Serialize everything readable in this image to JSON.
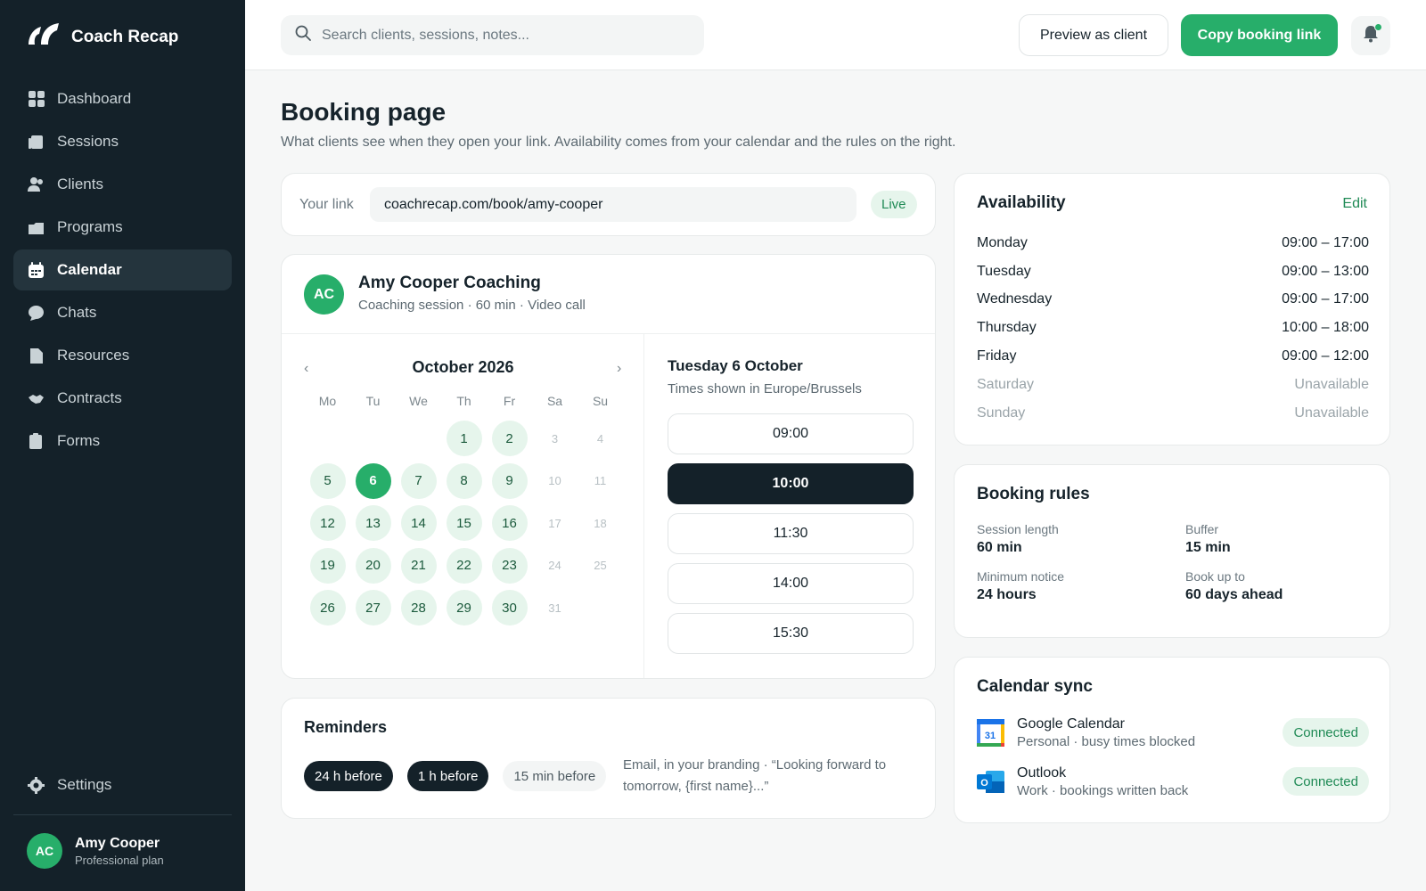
{
  "app": {
    "name": "Coach Recap"
  },
  "nav": {
    "items": [
      {
        "label": "Dashboard",
        "icon": "dashboard-icon"
      },
      {
        "label": "Sessions",
        "icon": "sessions-icon"
      },
      {
        "label": "Clients",
        "icon": "clients-icon"
      },
      {
        "label": "Programs",
        "icon": "programs-icon"
      },
      {
        "label": "Calendar",
        "icon": "calendar-icon",
        "active": true
      },
      {
        "label": "Chats",
        "icon": "chat-icon"
      },
      {
        "label": "Resources",
        "icon": "resources-icon"
      },
      {
        "label": "Contracts",
        "icon": "contracts-icon"
      },
      {
        "label": "Forms",
        "icon": "forms-icon"
      }
    ],
    "settings_label": "Settings"
  },
  "user": {
    "initials": "AC",
    "name": "Amy Cooper",
    "plan": "Professional plan"
  },
  "topbar": {
    "search_placeholder": "Search clients, sessions, notes...",
    "preview_label": "Preview as client",
    "copy_label": "Copy booking link"
  },
  "page": {
    "title": "Booking page",
    "subtitle": "What clients see when they open your link. Availability comes from your calendar and the rules on the right."
  },
  "link": {
    "label": "Your link",
    "url": "coachrecap.com/book/amy-cooper",
    "status": "Live"
  },
  "widget": {
    "initials": "AC",
    "coach_name": "Amy Cooper Coaching",
    "meta": "Coaching session · 60 min · Video call",
    "calendar": {
      "prev": "‹",
      "next": "›",
      "month": "October 2026",
      "weekdays": [
        "Mo",
        "Tu",
        "We",
        "Th",
        "Fr",
        "Sa",
        "Su"
      ],
      "lead_blanks": 3,
      "days": [
        {
          "n": "1",
          "s": "avail"
        },
        {
          "n": "2",
          "s": "avail"
        },
        {
          "n": "3",
          "s": "unavail"
        },
        {
          "n": "4",
          "s": "unavail"
        },
        {
          "n": "5",
          "s": "avail"
        },
        {
          "n": "6",
          "s": "selected"
        },
        {
          "n": "7",
          "s": "avail"
        },
        {
          "n": "8",
          "s": "avail"
        },
        {
          "n": "9",
          "s": "avail"
        },
        {
          "n": "10",
          "s": "unavail"
        },
        {
          "n": "11",
          "s": "unavail"
        },
        {
          "n": "12",
          "s": "avail"
        },
        {
          "n": "13",
          "s": "avail"
        },
        {
          "n": "14",
          "s": "avail"
        },
        {
          "n": "15",
          "s": "avail"
        },
        {
          "n": "16",
          "s": "avail"
        },
        {
          "n": "17",
          "s": "unavail"
        },
        {
          "n": "18",
          "s": "unavail"
        },
        {
          "n": "19",
          "s": "avail"
        },
        {
          "n": "20",
          "s": "avail"
        },
        {
          "n": "21",
          "s": "avail"
        },
        {
          "n": "22",
          "s": "avail"
        },
        {
          "n": "23",
          "s": "avail"
        },
        {
          "n": "24",
          "s": "unavail"
        },
        {
          "n": "25",
          "s": "unavail"
        },
        {
          "n": "26",
          "s": "avail"
        },
        {
          "n": "27",
          "s": "avail"
        },
        {
          "n": "28",
          "s": "avail"
        },
        {
          "n": "29",
          "s": "avail"
        },
        {
          "n": "30",
          "s": "avail"
        },
        {
          "n": "31",
          "s": "unavail"
        }
      ]
    },
    "slots": {
      "date": "Tuesday 6 October",
      "timezone": "Times shown in Europe/Brussels",
      "times": [
        {
          "t": "09:00",
          "selected": false
        },
        {
          "t": "10:00",
          "selected": true
        },
        {
          "t": "11:30",
          "selected": false
        },
        {
          "t": "14:00",
          "selected": false
        },
        {
          "t": "15:30",
          "selected": false
        }
      ]
    }
  },
  "reminders": {
    "title": "Reminders",
    "chips": [
      {
        "label": "24 h before",
        "on": true
      },
      {
        "label": "1 h before",
        "on": true
      },
      {
        "label": "15 min before",
        "on": false
      }
    ],
    "description": "Email, in your branding · “Looking forward to tomorrow, {first name}...”"
  },
  "availability": {
    "title": "Availability",
    "edit_label": "Edit",
    "rows": [
      {
        "day": "Monday",
        "hours": "09:00 – 17:00",
        "off": false
      },
      {
        "day": "Tuesday",
        "hours": "09:00 – 13:00",
        "off": false
      },
      {
        "day": "Wednesday",
        "hours": "09:00 – 17:00",
        "off": false
      },
      {
        "day": "Thursday",
        "hours": "10:00 – 18:00",
        "off": false
      },
      {
        "day": "Friday",
        "hours": "09:00 – 12:00",
        "off": false
      },
      {
        "day": "Saturday",
        "hours": "Unavailable",
        "off": true
      },
      {
        "day": "Sunday",
        "hours": "Unavailable",
        "off": true
      }
    ]
  },
  "rules": {
    "title": "Booking rules",
    "items": [
      {
        "label": "Session length",
        "value": "60 min"
      },
      {
        "label": "Buffer",
        "value": "15 min"
      },
      {
        "label": "Minimum notice",
        "value": "24 hours"
      },
      {
        "label": "Book up to",
        "value": "60 days ahead"
      }
    ]
  },
  "sync": {
    "title": "Calendar sync",
    "items": [
      {
        "name": "Google Calendar",
        "meta": "Personal · busy times blocked",
        "status": "Connected",
        "icon": "google-calendar-icon",
        "icon_text": "31"
      },
      {
        "name": "Outlook",
        "meta": "Work · bookings written back",
        "status": "Connected",
        "icon": "outlook-icon",
        "icon_text": "O"
      }
    ]
  },
  "colors": {
    "accent": "#27ae6a",
    "sidebar": "#142129",
    "dark": "#142129"
  }
}
